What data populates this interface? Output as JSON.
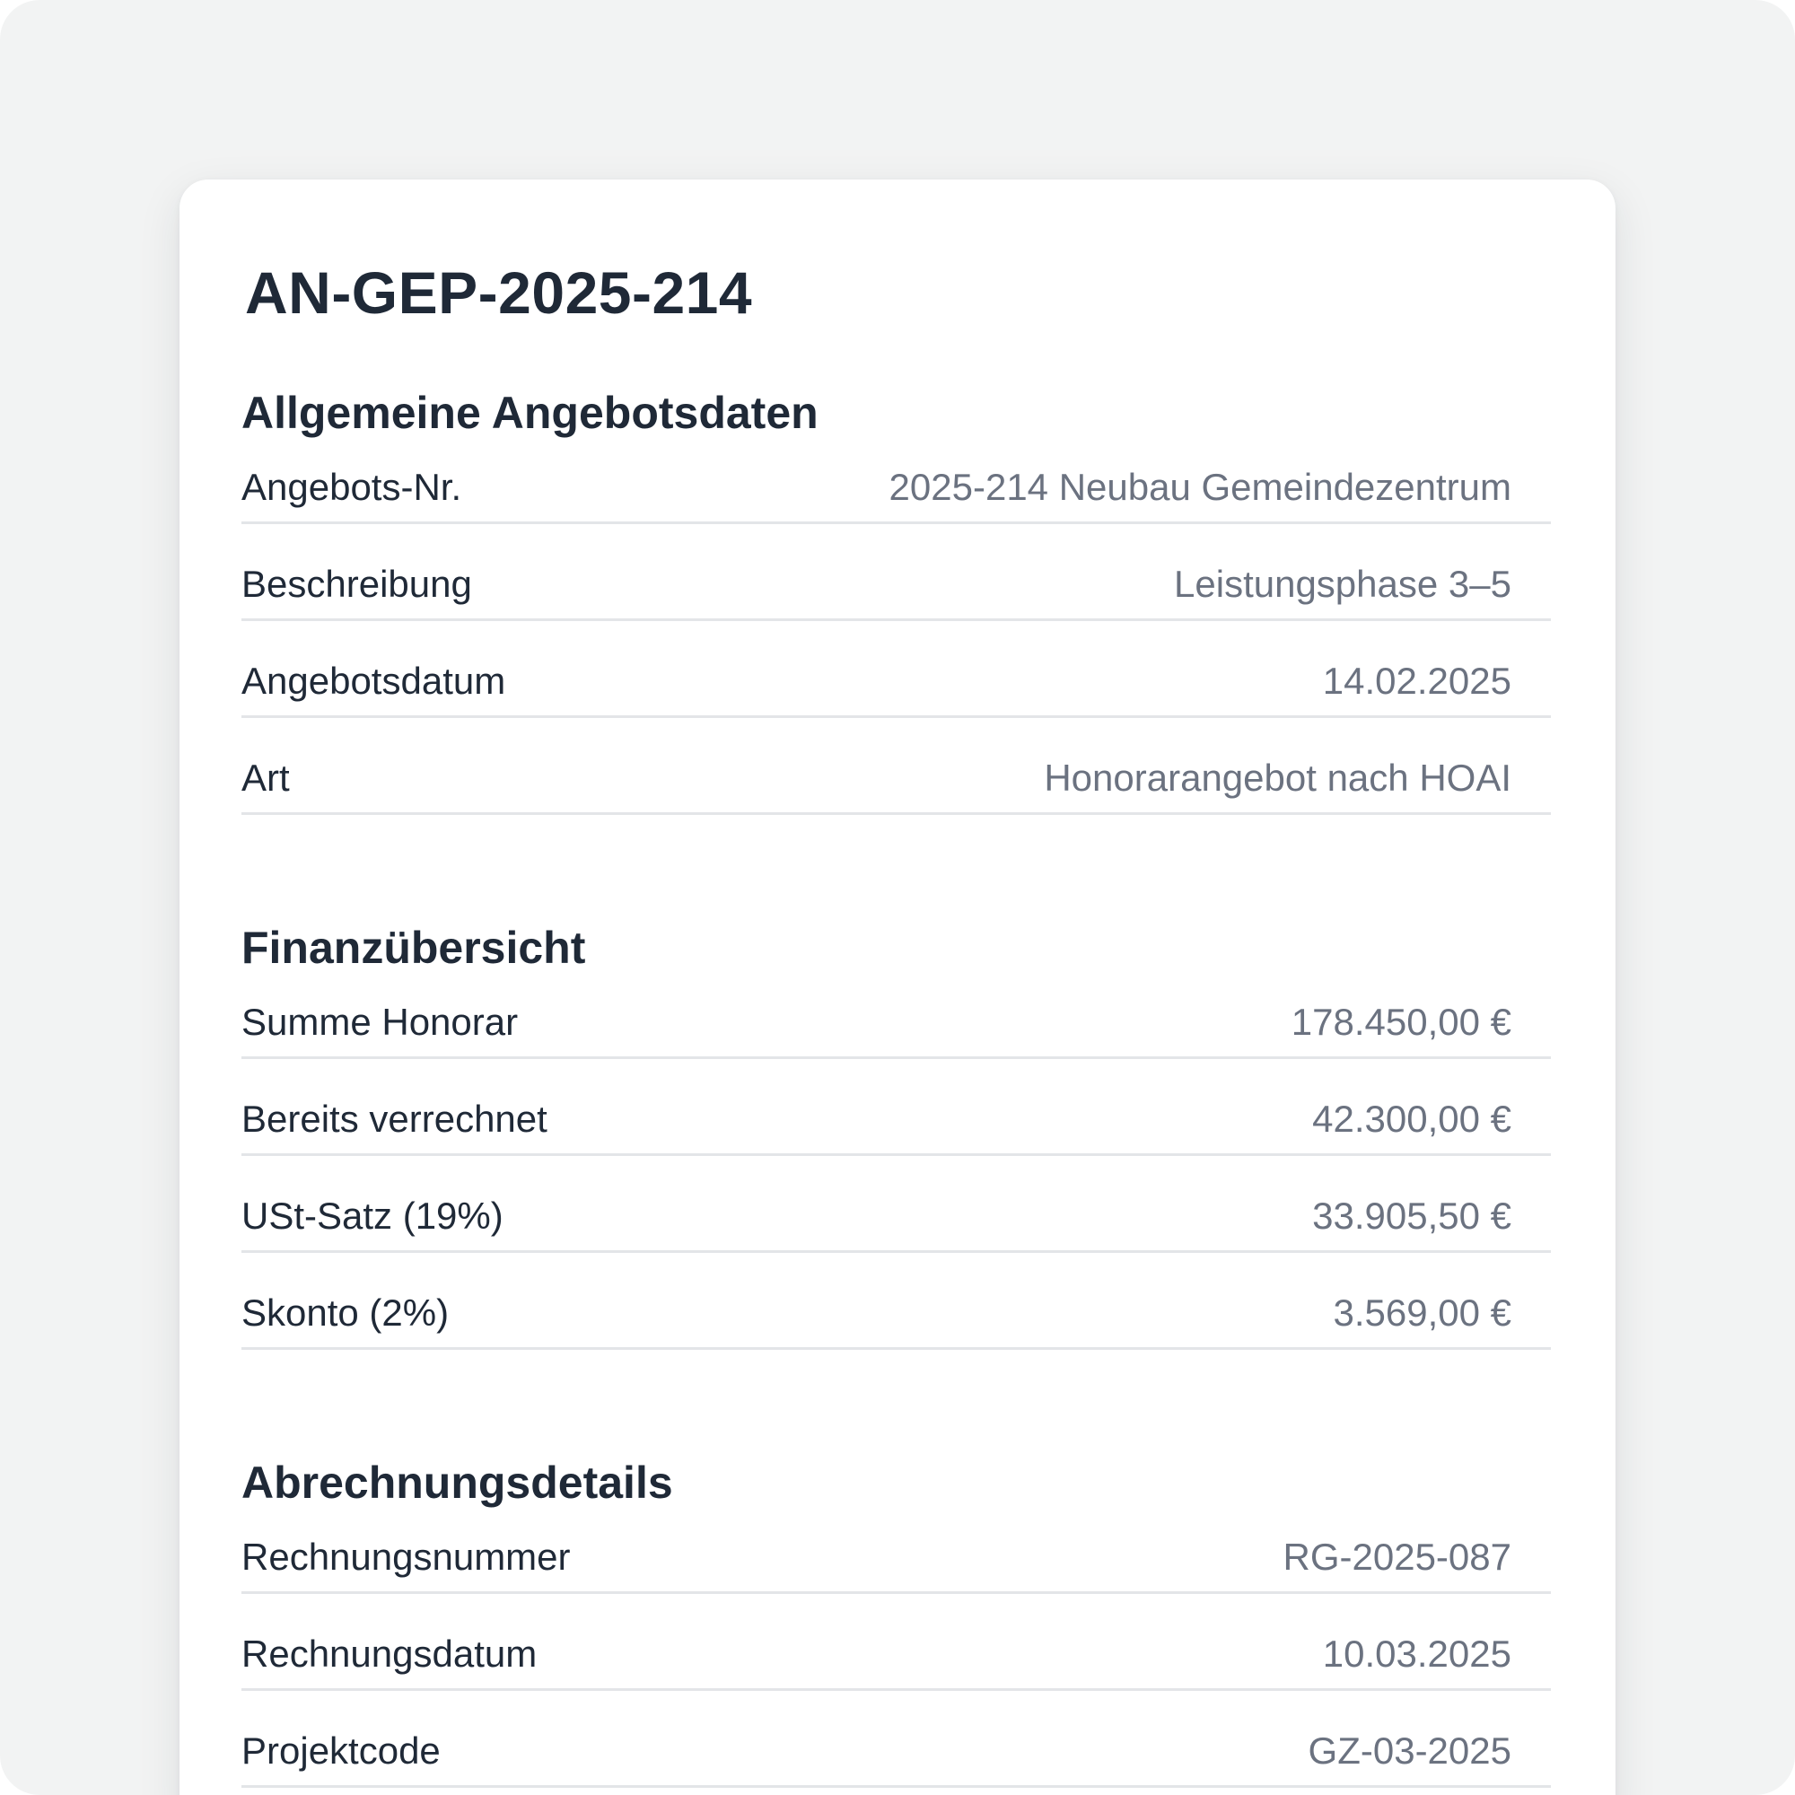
{
  "document": {
    "title": "AN-GEP-2025-214"
  },
  "sections": [
    {
      "title": "Allgemeine Angebotsdaten",
      "rows": [
        {
          "label": "Angebots-Nr.",
          "value": "2025-214 Neubau Gemeindezentrum"
        },
        {
          "label": "Beschreibung",
          "value": "Leistungsphase 3–5"
        },
        {
          "label": "Angebotsdatum",
          "value": "14.02.2025"
        },
        {
          "label": "Art",
          "value": "Honorarangebot nach HOAI"
        }
      ]
    },
    {
      "title": "Finanzübersicht",
      "rows": [
        {
          "label": "Summe Honorar",
          "value": "178.450,00 €"
        },
        {
          "label": "Bereits verrechnet",
          "value": "42.300,00 €"
        },
        {
          "label": "USt-Satz (19%)",
          "value": "33.905,50 €"
        },
        {
          "label": "Skonto (2%)",
          "value": "3.569,00 €"
        }
      ]
    },
    {
      "title": "Abrechnungsdetails",
      "rows": [
        {
          "label": "Rechnungsnummer",
          "value": "RG-2025-087"
        },
        {
          "label": "Rechnungsdatum",
          "value": "10.03.2025"
        },
        {
          "label": "Projektcode",
          "value": "GZ-03-2025"
        }
      ]
    }
  ]
}
